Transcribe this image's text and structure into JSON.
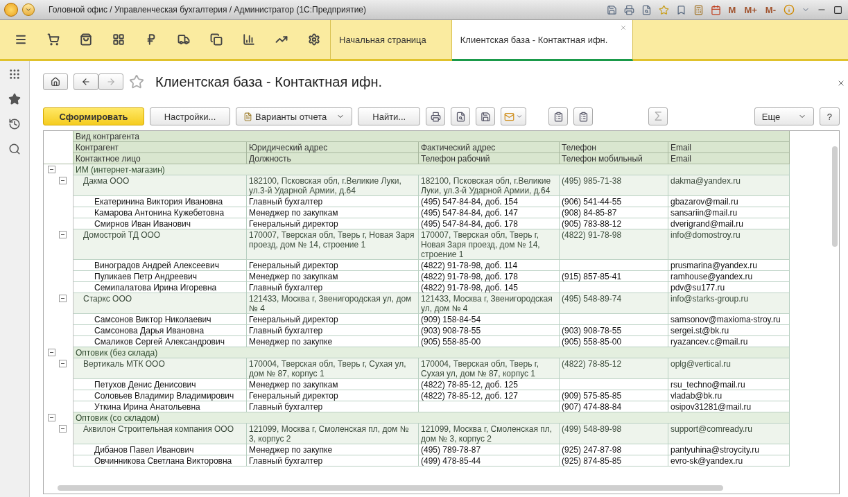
{
  "window": {
    "title": "Головной офис / Управленческая бухгалтерия / Администратор  (1С:Предприятие)",
    "memory_buttons": [
      "M",
      "M+",
      "M-"
    ]
  },
  "tabs": [
    {
      "label": "Начальная страница",
      "selected": false
    },
    {
      "label": "Клиентская база - Контактная ифн.",
      "selected": true
    }
  ],
  "form": {
    "title": "Клиентская база - Контактная ифн.",
    "favorite": false
  },
  "toolbar": {
    "generate": "Сформировать",
    "settings": "Настройки...",
    "variants": "Варианты отчета",
    "find": "Найти...",
    "sum": {
      "label": "Σ",
      "disabled": true
    },
    "more": "Еще",
    "help": "?"
  },
  "report": {
    "header_rows": [
      [
        "Вид контрагента"
      ],
      [
        "Контрагент",
        "Юридический адрес",
        "Фактический адрес",
        "Телефон",
        "Email"
      ],
      [
        "Контактное лицо",
        "Должность",
        "Телефон рабочий",
        "Телефон мобильный",
        "Email"
      ]
    ],
    "rows": [
      {
        "kind": "group",
        "expanded": true,
        "cells": [
          "ИМ (интернет-магазин)"
        ]
      },
      {
        "kind": "company",
        "expanded": true,
        "cells": [
          "Дакма ООО",
          "182100, Псковская обл, г.Великие Луки, ул.3-й Ударной Армии, д.64",
          "182100, Псковская обл, г.Великие Луки, ул.3-й Ударной Армии, д.64",
          "(495) 985-71-38",
          "dakma@yandex.ru"
        ]
      },
      {
        "kind": "contact",
        "cells": [
          "Екатеринина Виктория Ивановна",
          "Главный бухгалтер",
          "(495) 547-84-84, доб. 154",
          "(906) 541-44-55",
          "gbazarov@mail.ru"
        ]
      },
      {
        "kind": "contact",
        "cells": [
          "Камарова Антонина Кужебетовна",
          "Менеджер по закупкам",
          "(495) 547-84-84, доб. 147",
          "(908) 84-85-87",
          "sansariin@mail.ru"
        ]
      },
      {
        "kind": "contact",
        "cells": [
          "Смирнов Иван Иванович",
          "Генеральный директор",
          "(495) 547-84-84, доб. 178",
          "(905) 783-88-12",
          "dverigrand@mail.ru"
        ]
      },
      {
        "kind": "company",
        "expanded": true,
        "cells": [
          "Домострой ТД ООО",
          "170007, Тверская обл, Тверь г, Новая Заря проезд, дом № 14, строение 1",
          "170007, Тверская обл, Тверь г, Новая Заря проезд, дом № 14, строение 1",
          "(4822) 91-78-98",
          "info@domostroy.ru"
        ]
      },
      {
        "kind": "contact",
        "cells": [
          "Виноградов Андрей Алексеевич",
          "Генеральный директор",
          "(4822) 91-78-98, доб. 114",
          null,
          "prusmarina@yandex.ru"
        ]
      },
      {
        "kind": "contact",
        "cells": [
          "Пуликаев Петр Андреевич",
          "Менеджер по закупкам",
          "(4822) 91-78-98, доб. 178",
          "(915) 857-85-41",
          "ramhouse@yandex.ru"
        ]
      },
      {
        "kind": "contact",
        "cells": [
          "Семипалатова Ирина Игоревна",
          "Главный бухгалтер",
          "(4822) 91-78-98, доб. 145",
          null,
          "pdv@su177.ru"
        ]
      },
      {
        "kind": "company",
        "expanded": true,
        "cells": [
          "Старкс ООО",
          "121433, Москва г, Звенигородская ул, дом № 4",
          "121433, Москва г, Звенигородская ул, дом № 4",
          "(495) 548-89-74",
          "info@starks-group.ru"
        ]
      },
      {
        "kind": "contact",
        "cells": [
          "Самсонов Виктор Николаевич",
          "Генеральный директор",
          "(909) 158-84-54",
          null,
          "samsonov@maxioma-stroy.ru"
        ]
      },
      {
        "kind": "contact",
        "cells": [
          "Самсонова Дарья Ивановна",
          "Главный бухгалтер",
          "(903) 908-78-55",
          "(903) 908-78-55",
          "sergei.st@bk.ru"
        ]
      },
      {
        "kind": "contact",
        "cells": [
          "Смаликов Сергей Александрович",
          "Менеджер по закупке",
          "(905) 558-85-00",
          "(905) 558-85-00",
          "ryazancev.c@mail.ru"
        ]
      },
      {
        "kind": "group",
        "expanded": true,
        "cells": [
          "Оптовик (без склада)"
        ]
      },
      {
        "kind": "company",
        "expanded": true,
        "cells": [
          "Вертикаль МТК ООО",
          "170004, Тверская обл, Тверь г, Сухая ул, дом № 87, корпус 1",
          "170004, Тверская обл, Тверь г, Сухая ул, дом № 87, корпус 1",
          "(4822) 78-85-12",
          "oplg@vertical.ru"
        ]
      },
      {
        "kind": "contact",
        "cells": [
          "Петухов Денис Денисович",
          "Менеджер по закупкам",
          "(4822) 78-85-12, доб. 125",
          null,
          "rsu_techno@mail.ru"
        ]
      },
      {
        "kind": "contact",
        "cells": [
          "Соловьев Владимир Владимирович",
          "Генеральный директор",
          "(4822) 78-85-12, доб. 127",
          "(909) 575-85-85",
          "vladab@bk.ru"
        ]
      },
      {
        "kind": "contact",
        "cells": [
          "Уткина Ирина Анатольевна",
          "Главный бухгалтер",
          null,
          "(907) 474-88-84",
          "osipov31281@mail.ru"
        ]
      },
      {
        "kind": "group",
        "expanded": true,
        "cells": [
          "Оптовик (со складом)"
        ]
      },
      {
        "kind": "company",
        "expanded": true,
        "cells": [
          "Аквилон Строительная компания ООО",
          "121099, Москва г, Смоленская пл, дом № 3, корпус 2",
          "121099, Москва г, Смоленская пл, дом № 3, корпус 2",
          "(499) 548-89-98",
          "support@comready.ru"
        ]
      },
      {
        "kind": "contact",
        "cells": [
          "Дибанов Павел Иванович",
          "Менеджер по закупке",
          "(495) 789-78-87",
          "(925) 247-87-98",
          "pantyuhina@stroycity.ru"
        ]
      },
      {
        "kind": "contact",
        "cells": [
          "Овчинникова Светлана Викторовна",
          "Главный бухгалтер",
          "(499) 478-85-44",
          "(925) 874-85-85",
          "evro-sk@yandex.ru"
        ]
      }
    ]
  }
}
